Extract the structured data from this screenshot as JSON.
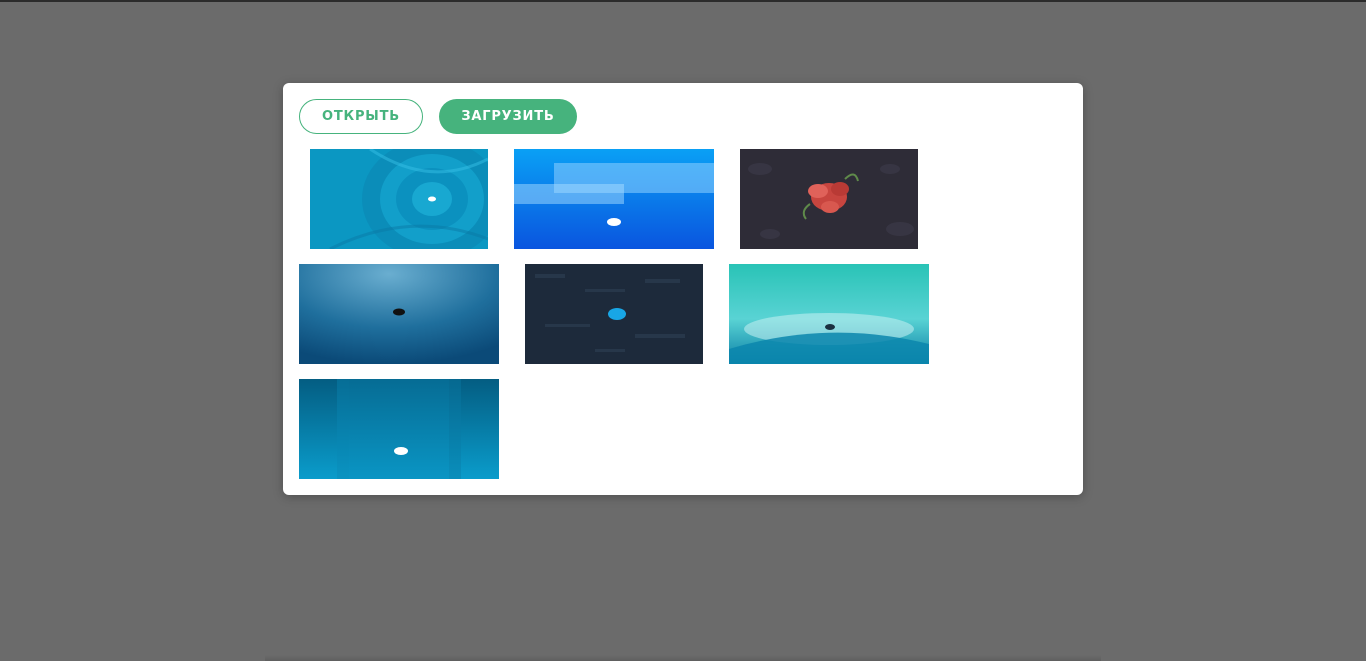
{
  "dialog": {
    "open_label": "ОТКРЫТЬ",
    "upload_label": "ЗАГРУЗИТЬ"
  },
  "wallpapers": [
    {
      "name": "blue-spiral",
      "colors": [
        "#0aa0c8",
        "#0b84b3",
        "#22b6dd"
      ]
    },
    {
      "name": "blue-stripes",
      "colors": [
        "#0a8ef0",
        "#0b5fe0",
        "#7fc8ff"
      ]
    },
    {
      "name": "dark-flower-xfce",
      "colors": [
        "#2d2b36",
        "#c8413a",
        "#3c3a46"
      ]
    },
    {
      "name": "blue-gradient-mouse",
      "colors": [
        "#5aa0c8",
        "#155f8f",
        "#0b4b78"
      ]
    },
    {
      "name": "dark-texture-mouse",
      "colors": [
        "#1c2a3c",
        "#2b3b50",
        "#16a0e0"
      ]
    },
    {
      "name": "teal-wave",
      "colors": [
        "#2ec4b8",
        "#7fe0e2",
        "#0b7fa5"
      ]
    },
    {
      "name": "deep-blue-columns",
      "colors": [
        "#035e80",
        "#0a8cb8",
        "#0b97c6"
      ]
    }
  ]
}
